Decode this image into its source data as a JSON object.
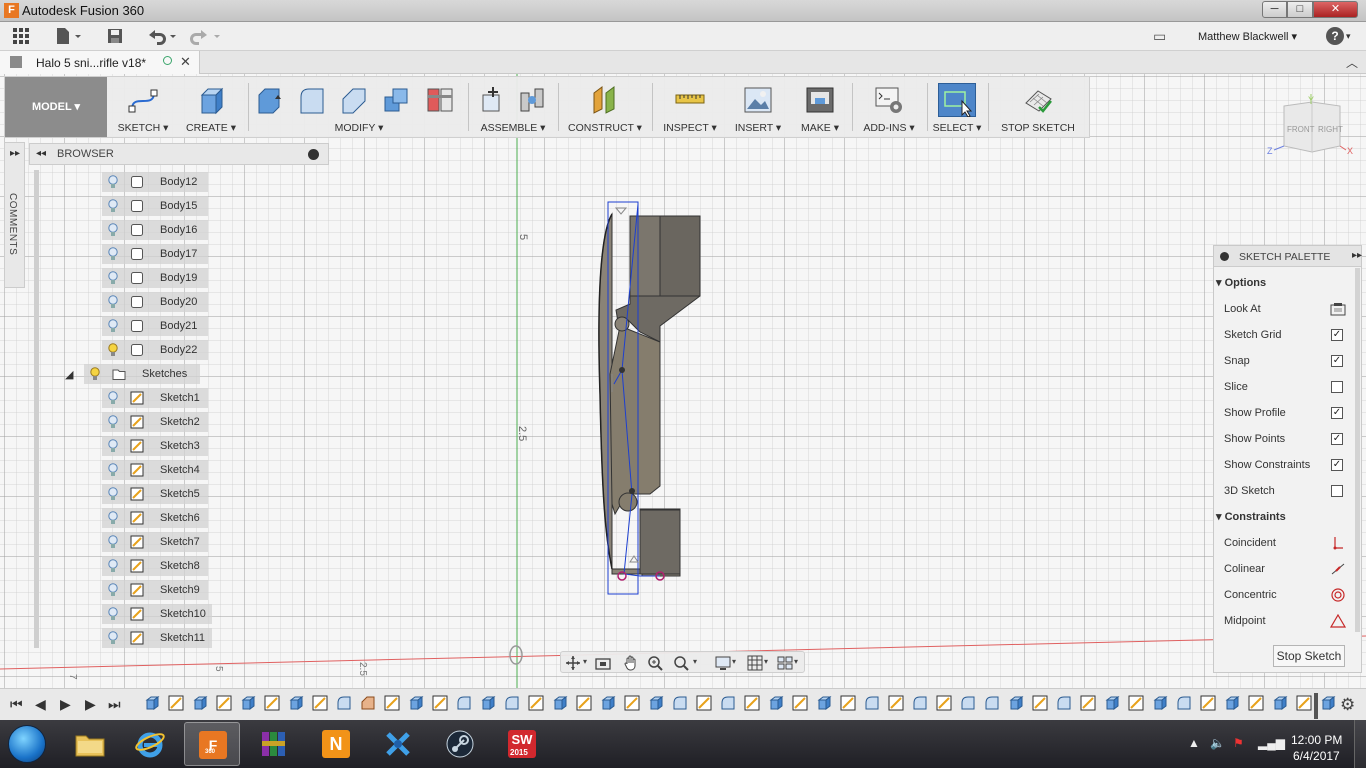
{
  "window": {
    "title": "Autodesk Fusion 360",
    "min_glyph": "─",
    "max_glyph": "□",
    "close_glyph": "✕"
  },
  "qat": {
    "user_name": "Matthew Blackwell ▾",
    "help_glyph": "?"
  },
  "document_tab": {
    "label": "Halo 5 sni...rifle v18*",
    "close_glyph": "✕"
  },
  "toolbar": {
    "workspace": "MODEL ▾",
    "groups": [
      {
        "label": "SKETCH ▾"
      },
      {
        "label": "CREATE ▾"
      },
      {
        "label": "MODIFY ▾"
      },
      {
        "label": "ASSEMBLE ▾"
      },
      {
        "label": "CONSTRUCT ▾"
      },
      {
        "label": "INSPECT ▾"
      },
      {
        "label": "INSERT ▾"
      },
      {
        "label": "MAKE ▾"
      },
      {
        "label": "ADD-INS ▾"
      },
      {
        "label": "SELECT ▾"
      },
      {
        "label": "STOP SKETCH"
      }
    ]
  },
  "viewcube": {
    "front": "FRONT",
    "right": "RIGHT",
    "axis_y": "Y",
    "axis_z": "Z",
    "axis_x": "X"
  },
  "browser": {
    "comments_label": "COMMENTS",
    "title": "BROWSER",
    "items": [
      {
        "label": "Body12"
      },
      {
        "label": "Body15"
      },
      {
        "label": "Body16"
      },
      {
        "label": "Body17"
      },
      {
        "label": "Body19"
      },
      {
        "label": "Body20"
      },
      {
        "label": "Body21"
      },
      {
        "label": "Body22"
      },
      {
        "label": "Sketches"
      },
      {
        "label": "Sketch1"
      },
      {
        "label": "Sketch2"
      },
      {
        "label": "Sketch3"
      },
      {
        "label": "Sketch4"
      },
      {
        "label": "Sketch5"
      },
      {
        "label": "Sketch6"
      },
      {
        "label": "Sketch7"
      },
      {
        "label": "Sketch8"
      },
      {
        "label": "Sketch9"
      },
      {
        "label": "Sketch10"
      },
      {
        "label": "Sketch11"
      }
    ]
  },
  "canvas": {
    "ruler_upper": "5",
    "ruler_lower": "2.5",
    "ruler_bottom_a": "7",
    "ruler_bottom_b": "5",
    "ruler_bottom_c": "2.5"
  },
  "sketch_palette": {
    "title": "SKETCH PALETTE",
    "options_heading": "Options",
    "options": [
      {
        "label": "Look At",
        "checked": null
      },
      {
        "label": "Sketch Grid",
        "checked": true
      },
      {
        "label": "Snap",
        "checked": true
      },
      {
        "label": "Slice",
        "checked": false
      },
      {
        "label": "Show Profile",
        "checked": true
      },
      {
        "label": "Show Points",
        "checked": true
      },
      {
        "label": "Show Constraints",
        "checked": true
      },
      {
        "label": "3D Sketch",
        "checked": false
      }
    ],
    "constraints_heading": "Constraints",
    "constraints": [
      {
        "label": "Coincident"
      },
      {
        "label": "Colinear"
      },
      {
        "label": "Concentric"
      },
      {
        "label": "Midpoint"
      }
    ],
    "stop_button": "Stop Sketch"
  },
  "taskbar": {
    "clock_time": "12:00 PM",
    "clock_date": "6/4/2017",
    "apps": [
      {
        "name": "file-explorer"
      },
      {
        "name": "internet-explorer"
      },
      {
        "name": "fusion-360",
        "label": "F",
        "sublabel": "360"
      },
      {
        "name": "winrar"
      },
      {
        "name": "nuke",
        "label": "N"
      },
      {
        "name": "xsplit"
      },
      {
        "name": "steam"
      },
      {
        "name": "solidworks-2015",
        "label": "SW",
        "sublabel": "2015"
      }
    ]
  },
  "colors": {
    "accent_blue": "#4e86c9",
    "fusion_orange": "#e87722",
    "body_fill": "#7d776c",
    "sketch_blue": "#1c3fd0",
    "constraint_magenta": "#b0206e",
    "axis_green": "#4caf50",
    "axis_red": "#e06060"
  }
}
